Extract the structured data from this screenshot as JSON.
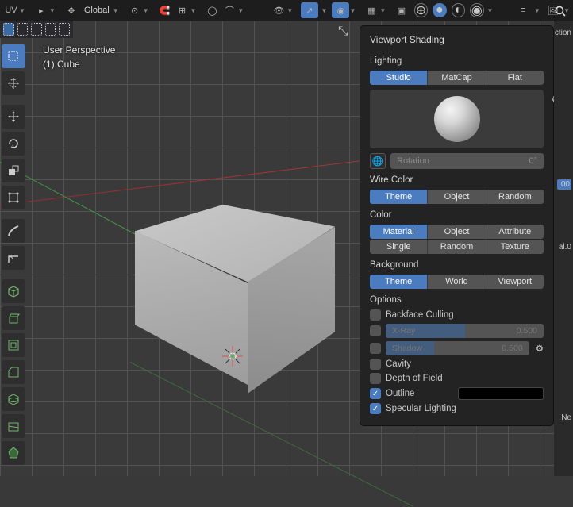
{
  "topbar": {
    "uv": "UV",
    "orientation": "Global"
  },
  "info": {
    "line1": "User Perspective",
    "line2": "(1) Cube"
  },
  "popover": {
    "title": "Viewport Shading",
    "lighting_label": "Lighting",
    "lighting_modes": [
      "Studio",
      "MatCap",
      "Flat"
    ],
    "lighting_active": 0,
    "rotation_label": "Rotation",
    "rotation_value": "0°",
    "wire_color_label": "Wire Color",
    "wire_color_opts": [
      "Theme",
      "Object",
      "Random"
    ],
    "wire_color_active": 0,
    "color_label": "Color",
    "color_opts_row1": [
      "Material",
      "Object",
      "Attribute"
    ],
    "color_opts_row2": [
      "Single",
      "Random",
      "Texture"
    ],
    "color_active": "Material",
    "background_label": "Background",
    "background_opts": [
      "Theme",
      "World",
      "Viewport"
    ],
    "background_active": 0,
    "options_label": "Options",
    "backface": "Backface Culling",
    "xray_label": "X-Ray",
    "xray_value": "0.500",
    "shadow_label": "Shadow",
    "shadow_value": "0.500",
    "cavity": "Cavity",
    "dof": "Depth of Field",
    "outline": "Outline",
    "specular": "Specular Lighting"
  },
  "edge": {
    "ction": "ction",
    "val1": ".00",
    "val2": "al.0",
    "ne": "Ne"
  }
}
